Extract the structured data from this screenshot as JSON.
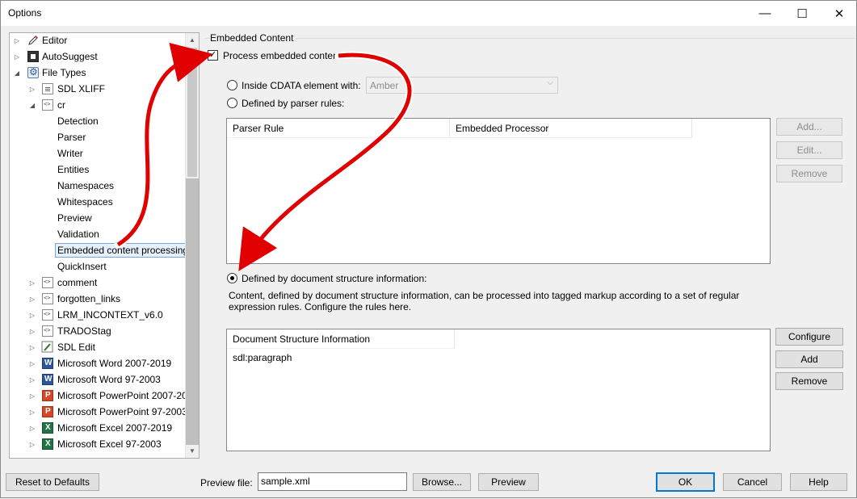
{
  "window": {
    "title": "Options",
    "controls": {
      "minimize": "—",
      "maximize": "☐",
      "close": "✕"
    }
  },
  "tree": {
    "items": [
      {
        "label": "Editor",
        "expander": "▷",
        "icon": "pencil-icon"
      },
      {
        "label": "AutoSuggest",
        "expander": "▷",
        "icon": "autosuggest-icon"
      },
      {
        "label": "File Types",
        "expander": "◢",
        "icon": "gear-icon"
      },
      {
        "label": "SDL XLIFF",
        "expander": "▷",
        "icon": "document-icon"
      },
      {
        "label": "cr",
        "expander": "◢",
        "icon": "xml-file-icon"
      },
      {
        "label": "Detection"
      },
      {
        "label": "Parser"
      },
      {
        "label": "Writer"
      },
      {
        "label": "Entities"
      },
      {
        "label": "Namespaces"
      },
      {
        "label": "Whitespaces"
      },
      {
        "label": "Preview"
      },
      {
        "label": "Validation"
      },
      {
        "label": "Embedded content processing",
        "selected": true
      },
      {
        "label": "QuickInsert"
      },
      {
        "label": "comment",
        "expander": "▷",
        "icon": "xml-file-icon"
      },
      {
        "label": "forgotten_links",
        "expander": "▷",
        "icon": "xml-file-icon"
      },
      {
        "label": "LRM_INCONTEXT_v6.0",
        "expander": "▷",
        "icon": "xml-file-icon"
      },
      {
        "label": "TRADOStag",
        "expander": "▷",
        "icon": "tradostag-icon"
      },
      {
        "label": "SDL Edit",
        "expander": "▷",
        "icon": "sdl-edit-icon"
      },
      {
        "label": "Microsoft Word 2007-2019",
        "expander": "▷",
        "icon": "word-icon"
      },
      {
        "label": "Microsoft Word 97-2003",
        "expander": "▷",
        "icon": "word-icon"
      },
      {
        "label": "Microsoft PowerPoint 2007-20",
        "expander": "▷",
        "icon": "powerpoint-icon"
      },
      {
        "label": "Microsoft PowerPoint 97-2003",
        "expander": "▷",
        "icon": "powerpoint-icon"
      },
      {
        "label": "Microsoft Excel 2007-2019",
        "expander": "▷",
        "icon": "excel-icon"
      },
      {
        "label": "Microsoft Excel 97-2003",
        "expander": "▷",
        "icon": "excel-icon"
      }
    ],
    "scroll_up": "▲",
    "scroll_down": "▼"
  },
  "embedded": {
    "group_title": "Embedded Content",
    "process_checkbox": {
      "label": "Process embedded content",
      "checked": true,
      "mark": "✓"
    },
    "inside_cdata": {
      "label": "Inside CDATA element with:",
      "checked": false
    },
    "cdata_combo": {
      "value": "Amber",
      "chevron": "⌵"
    },
    "parser_rules": {
      "label": "Defined by parser rules:",
      "checked": false
    },
    "parser_grid": {
      "columns": [
        "Parser Rule",
        "Embedded Processor"
      ]
    },
    "parser_buttons": {
      "add": "Add...",
      "edit": "Edit...",
      "remove": "Remove"
    },
    "doc_structure": {
      "label": "Defined by document structure information:",
      "checked": true
    },
    "description": "Content, defined by document structure information, can be processed into tagged markup according to a set of regular expression rules. Configure the rules here.",
    "dsi_grid": {
      "columns": [
        "Document Structure Information"
      ],
      "rows": [
        "sdl:paragraph"
      ]
    },
    "dsi_buttons": {
      "configure": "Configure",
      "add": "Add",
      "remove": "Remove"
    }
  },
  "footer": {
    "reset": "Reset to Defaults",
    "preview_label": "Preview file:",
    "preview_value": "sample.xml",
    "browse": "Browse...",
    "preview": "Preview",
    "ok": "OK",
    "cancel": "Cancel",
    "help": "Help"
  },
  "colors": {
    "accent": "#0078d7",
    "arrow": "#e00000"
  }
}
